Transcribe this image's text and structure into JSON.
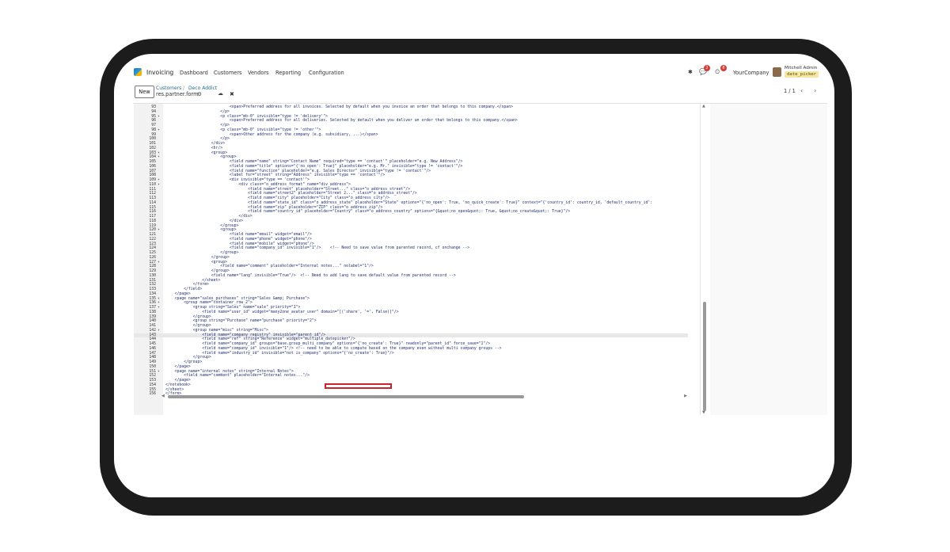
{
  "navbar": {
    "app_name": "Invoicing",
    "menu": [
      "Dashboard",
      "Customers",
      "Vendors",
      "Reporting",
      "Configuration"
    ],
    "chat_badge": "2",
    "activity_badge": "8",
    "company": "YourCompany",
    "user_name": "Mitchell Admin",
    "db_name": "date_picker"
  },
  "control_panel": {
    "new_label": "New",
    "breadcrumb": [
      "Customers",
      "Deco Addict"
    ],
    "breadcrumb_sep": "/",
    "record_name": "res.partner.form",
    "pager": "1 / 1"
  },
  "icons": {
    "gear": "⚙",
    "cloud": "☁",
    "discard": "✖",
    "bug": "✱",
    "chat": "💬",
    "activity": "⏲",
    "prev": "‹",
    "next": "›"
  },
  "code": {
    "active_line": 143,
    "highlight_token": "widget=\"multiple_datepicker\"",
    "lines": [
      {
        "n": 93,
        "fold": "",
        "text": "                            <span>Preferred address for all invoices. Selected by default when you invoice an order that belongs to this company.</span>"
      },
      {
        "n": 94,
        "fold": "",
        "text": "                        </p>"
      },
      {
        "n": 95,
        "fold": "▾",
        "text": "                        <p class=\"mb-0\" invisible=\"type != 'delivery'\">"
      },
      {
        "n": 96,
        "fold": "",
        "text": "                            <span>Preferred address for all deliveries. Selected by default when you deliver an order that belongs to this company.</span>"
      },
      {
        "n": 97,
        "fold": "",
        "text": "                        </p>"
      },
      {
        "n": 98,
        "fold": "▾",
        "text": "                        <p class=\"mb-0\" invisible=\"type != 'other'\">"
      },
      {
        "n": 99,
        "fold": "",
        "text": "                            <span>Other address for the company (e.g. subsidiary, ...)</span>"
      },
      {
        "n": 100,
        "fold": "",
        "text": "                        </p>"
      },
      {
        "n": 101,
        "fold": "",
        "text": "                    </div>"
      },
      {
        "n": 102,
        "fold": "",
        "text": "                    <hr/>"
      },
      {
        "n": 103,
        "fold": "▾",
        "text": "                    <group>"
      },
      {
        "n": 104,
        "fold": "▾",
        "text": "                        <group>"
      },
      {
        "n": 105,
        "fold": "",
        "text": "                            <field name=\"name\" string=\"Contact Name\" required=\"type == 'contact'\" placeholder=\"e.g. New Address\"/>"
      },
      {
        "n": 106,
        "fold": "",
        "text": "                            <field name=\"title\" options=\"{'no_open': True}\" placeholder=\"e.g. Mr.\" invisible=\"type != 'contact'\"/>"
      },
      {
        "n": 107,
        "fold": "",
        "text": "                            <field name=\"function\" placeholder=\"e.g. Sales Director\" invisible=\"type != 'contact'\"/>"
      },
      {
        "n": 108,
        "fold": "",
        "text": "                            <label for=\"street\" string=\"Address\" invisible=\"type == 'contact'\"/>"
      },
      {
        "n": 109,
        "fold": "▾",
        "text": "                            <div invisible=\"type == 'contact'\">"
      },
      {
        "n": 110,
        "fold": "▾",
        "text": "                                <div class=\"o_address_format\" name=\"div_address\">"
      },
      {
        "n": 111,
        "fold": "",
        "text": "                                    <field name=\"street\" placeholder=\"Street...\" class=\"o_address_street\"/>"
      },
      {
        "n": 112,
        "fold": "",
        "text": "                                    <field name=\"street2\" placeholder=\"Street 2...\" class=\"o_address_street\"/>"
      },
      {
        "n": 113,
        "fold": "",
        "text": "                                    <field name=\"city\" placeholder=\"City\" class=\"o_address_city\"/>"
      },
      {
        "n": 114,
        "fold": "",
        "text": "                                    <field name=\"state_id\" class=\"o_address_state\" placeholder=\"State\" options=\"{'no_open': True, 'no_quick_create': True}\" context=\"{'country_id': country_id, 'default_country_id':"
      },
      {
        "n": 115,
        "fold": "",
        "text": "                                    <field name=\"zip\" placeholder=\"ZIP\" class=\"o_address_zip\"/>"
      },
      {
        "n": 116,
        "fold": "",
        "text": "                                    <field name=\"country_id\" placeholder=\"Country\" class=\"o_address_country\" options=\"{&quot;no_open&quot;: True, &quot;no_create&quot;: True}\"/>"
      },
      {
        "n": 117,
        "fold": "",
        "text": "                                </div>"
      },
      {
        "n": 118,
        "fold": "",
        "text": "                            </div>"
      },
      {
        "n": 119,
        "fold": "",
        "text": "                        </group>"
      },
      {
        "n": 120,
        "fold": "▾",
        "text": "                        <group>"
      },
      {
        "n": 121,
        "fold": "",
        "text": "                            <field name=\"email\" widget=\"email\"/>"
      },
      {
        "n": 122,
        "fold": "",
        "text": "                            <field name=\"phone\" widget=\"phone\"/>"
      },
      {
        "n": 123,
        "fold": "",
        "text": "                            <field name=\"mobile\" widget=\"phone\"/>"
      },
      {
        "n": 124,
        "fold": "",
        "text": "                            <field name=\"company_id\" invisible=\"1\"/>    <!-- Need to save value from parented record, cf onchange -->"
      },
      {
        "n": 125,
        "fold": "",
        "text": "                        </group>"
      },
      {
        "n": 126,
        "fold": "",
        "text": "                    </group>"
      },
      {
        "n": 127,
        "fold": "▾",
        "text": "                    <group>"
      },
      {
        "n": 128,
        "fold": "",
        "text": "                        <field name=\"comment\" placeholder=\"Internal notes...\" nolabel=\"1\"/>"
      },
      {
        "n": 129,
        "fold": "",
        "text": "                    </group>"
      },
      {
        "n": 130,
        "fold": "",
        "text": "                    <field name=\"lang\" invisible=\"True\"/>  <!-- Need to add lang to save default value from parented record -->"
      },
      {
        "n": 131,
        "fold": "",
        "text": "                </sheet>"
      },
      {
        "n": 132,
        "fold": "",
        "text": "            </form>"
      },
      {
        "n": 133,
        "fold": "",
        "text": "        </field>"
      },
      {
        "n": 134,
        "fold": "",
        "text": "    </page>"
      },
      {
        "n": 135,
        "fold": "▾",
        "text": "    <page name=\"sales_purchases\" string=\"Sales &amp; Purchase\">"
      },
      {
        "n": 136,
        "fold": "▾",
        "text": "        <group name=\"container_row_2\">"
      },
      {
        "n": 137,
        "fold": "▾",
        "text": "            <group string=\"Sales\" name=\"sale\" priority=\"1\">"
      },
      {
        "n": 138,
        "fold": "",
        "text": "                <field name=\"user_id\" widget=\"many2one_avatar_user\" domain=\"[('share', '=', False)]\"/>"
      },
      {
        "n": 139,
        "fold": "",
        "text": "            </group>"
      },
      {
        "n": 140,
        "fold": "",
        "text": "            <group string=\"Purchase\" name=\"purchase\" priority=\"2\">"
      },
      {
        "n": 141,
        "fold": "",
        "text": "            </group>"
      },
      {
        "n": 142,
        "fold": "▾",
        "text": "            <group name=\"misc\" string=\"Misc\">"
      },
      {
        "n": 143,
        "fold": "",
        "text": "                <field name=\"company_registry\" invisible=\"parent_id\"/>"
      },
      {
        "n": 144,
        "fold": "",
        "text": "                <field name=\"ref\" string=\"Reference\" widget=\"multiple_datepicker\"/>"
      },
      {
        "n": 145,
        "fold": "",
        "text": "                <field name=\"company_id\" groups=\"base.group_multi_company\" options=\"{'no_create': True}\" readonly=\"parent_id\" force_save=\"1\"/>"
      },
      {
        "n": 146,
        "fold": "",
        "text": "                <field name=\"company_id\" invisible=\"1\"/> <!-- need to be able to compute based on the company even without multi company groups -->"
      },
      {
        "n": 147,
        "fold": "",
        "text": "                <field name=\"industry_id\" invisible=\"not is_company\" options=\"{'no_create': True}\"/>"
      },
      {
        "n": 148,
        "fold": "",
        "text": "            </group>"
      },
      {
        "n": 149,
        "fold": "",
        "text": "        </group>"
      },
      {
        "n": 150,
        "fold": "",
        "text": "    </page>"
      },
      {
        "n": 151,
        "fold": "▾",
        "text": "    <page name=\"internal_notes\" string=\"Internal Notes\">"
      },
      {
        "n": 152,
        "fold": "",
        "text": "        <field name=\"comment\" placeholder=\"Internal notes...\"/>"
      },
      {
        "n": 153,
        "fold": "",
        "text": "    </page>"
      },
      {
        "n": 154,
        "fold": "",
        "text": "</notebook>"
      },
      {
        "n": 155,
        "fold": "",
        "text": "</sheet>"
      },
      {
        "n": 156,
        "fold": "",
        "text": "</form>"
      }
    ]
  }
}
